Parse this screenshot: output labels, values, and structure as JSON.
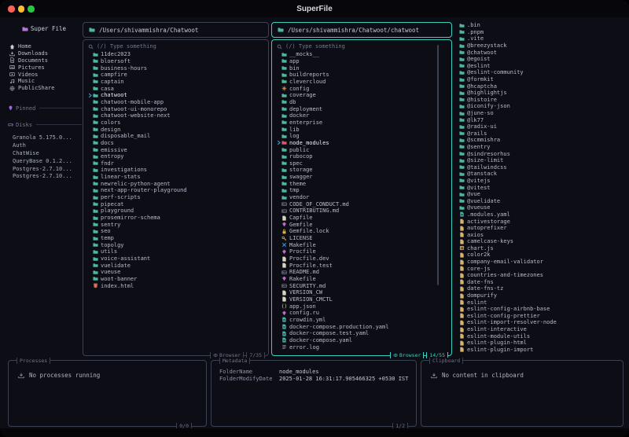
{
  "window": {
    "title": "SuperFile"
  },
  "colors": {
    "accent": "#39d0c2",
    "border": "#3a4150",
    "cursor_arrow": "#38a8e8",
    "background": "#0d0d16",
    "folder": "#4db99c",
    "node_modules_folder": "#d4596b"
  },
  "icon_colors": {
    "folder": "#4db99c",
    "file": "#d8d4c2",
    "md": "#8a93a5",
    "gem": "#bd6bc9",
    "lock": "#d9b54e",
    "key": "#d9b54e",
    "tools": "#5a9fd6",
    "braces": "#d9b54e",
    "yaml": "#45b7aa",
    "log": "#9aa2b1",
    "html": "#dd6b45",
    "gear": "#d98c4a",
    "js": "#d98c4a",
    "pkg": "#d8b46a",
    "home": "#c2c7d2",
    "tray": "#aeb8c8",
    "docfile": "#c2c7d2",
    "pictures": "#c2c7d2",
    "videos": "#c2c7d2",
    "music": "#aeb8c8",
    "globe": "#aeb8c8"
  },
  "sidebar": {
    "title": "Super File",
    "nav": [
      {
        "icon": "home",
        "label": "Home"
      },
      {
        "icon": "tray",
        "label": "Downloads"
      },
      {
        "icon": "docfile",
        "label": "Documents"
      },
      {
        "icon": "pictures",
        "label": "Pictures"
      },
      {
        "icon": "videos",
        "label": "Videos"
      },
      {
        "icon": "music",
        "label": "Music"
      },
      {
        "icon": "globe",
        "label": "PublicShare"
      }
    ],
    "pinned_label": "Pinned",
    "disks_label": "Disks",
    "disks": [
      {
        "label": "Granola 5.175.0..."
      },
      {
        "label": "Auth"
      },
      {
        "label": "ChatWise"
      },
      {
        "label": "QueryBase 0.1.2..."
      },
      {
        "label": "Postgres-2.7.10..."
      },
      {
        "label": "Postgres-2.7.10..."
      }
    ]
  },
  "panel1": {
    "path": "/Users/shivammishra/Chatwoot",
    "search_placeholder": "(/) Type something",
    "footer_label": "Browser",
    "footer_count": "7/35",
    "files": [
      {
        "icon": "folder",
        "name": "11dec2023"
      },
      {
        "icon": "folder",
        "name": "bloersoft"
      },
      {
        "icon": "folder",
        "name": "business-hours"
      },
      {
        "icon": "folder",
        "name": "campfire"
      },
      {
        "icon": "folder",
        "name": "captain"
      },
      {
        "icon": "folder",
        "name": "casa"
      },
      {
        "icon": "folder",
        "name": "chatwoot",
        "selected": true
      },
      {
        "icon": "folder",
        "name": "chatwoot-mobile-app"
      },
      {
        "icon": "folder",
        "name": "chatwoot-ui-monorepo"
      },
      {
        "icon": "folder",
        "name": "chatwoot-website-next"
      },
      {
        "icon": "folder",
        "name": "colors"
      },
      {
        "icon": "folder",
        "name": "design"
      },
      {
        "icon": "folder",
        "name": "disposable_mail"
      },
      {
        "icon": "folder",
        "name": "docs"
      },
      {
        "icon": "folder",
        "name": "emissive"
      },
      {
        "icon": "folder",
        "name": "entropy"
      },
      {
        "icon": "folder",
        "name": "fndr"
      },
      {
        "icon": "folder",
        "name": "investigations"
      },
      {
        "icon": "folder",
        "name": "linear-stats"
      },
      {
        "icon": "folder",
        "name": "newrelic-python-agent"
      },
      {
        "icon": "folder",
        "name": "next-app-router-playground"
      },
      {
        "icon": "folder",
        "name": "perf-scripts"
      },
      {
        "icon": "folder",
        "name": "pipecat"
      },
      {
        "icon": "folder",
        "name": "playground"
      },
      {
        "icon": "folder",
        "name": "prosemirror-schema"
      },
      {
        "icon": "folder",
        "name": "sentry"
      },
      {
        "icon": "folder",
        "name": "seo"
      },
      {
        "icon": "folder",
        "name": "temp"
      },
      {
        "icon": "folder",
        "name": "topolgy"
      },
      {
        "icon": "folder",
        "name": "utils"
      },
      {
        "icon": "folder",
        "name": "voice-assistant"
      },
      {
        "icon": "folder",
        "name": "vuelidate"
      },
      {
        "icon": "folder",
        "name": "vueuse"
      },
      {
        "icon": "folder",
        "name": "woot-banner"
      },
      {
        "icon": "html",
        "name": "index.html"
      }
    ]
  },
  "panel2": {
    "path": "/Users/shivammishra/Chatwoot/chatwoot",
    "search_placeholder": "(/) Type something",
    "footer_label": "Browser",
    "footer_count": "14/55",
    "files": [
      {
        "icon": "folder",
        "name": "__mocks__"
      },
      {
        "icon": "folder",
        "name": "app"
      },
      {
        "icon": "folder",
        "name": "bin"
      },
      {
        "icon": "folder",
        "name": "buildreports"
      },
      {
        "icon": "folder",
        "name": "clevercloud"
      },
      {
        "icon": "gear",
        "name": "config"
      },
      {
        "icon": "folder",
        "name": "coverage"
      },
      {
        "icon": "folder",
        "name": "db"
      },
      {
        "icon": "folder",
        "name": "deployment"
      },
      {
        "icon": "folder",
        "name": "docker"
      },
      {
        "icon": "folder",
        "name": "enterprise"
      },
      {
        "icon": "folder",
        "name": "lib"
      },
      {
        "icon": "folder",
        "name": "log"
      },
      {
        "icon": "folder",
        "name": "node_modules",
        "color": "#d4596b",
        "selected": true
      },
      {
        "icon": "folder",
        "name": "public"
      },
      {
        "icon": "folder",
        "name": "rubocop"
      },
      {
        "icon": "folder",
        "name": "spec"
      },
      {
        "icon": "folder",
        "name": "storage"
      },
      {
        "icon": "folder",
        "name": "swagger"
      },
      {
        "icon": "folder",
        "name": "theme"
      },
      {
        "icon": "folder",
        "name": "tmp"
      },
      {
        "icon": "folder",
        "name": "vendor"
      },
      {
        "icon": "md",
        "name": "CODE_OF_CONDUCT.md"
      },
      {
        "icon": "md",
        "name": "CONTRIBUTING.md"
      },
      {
        "icon": "file",
        "name": "Capfile"
      },
      {
        "icon": "gem",
        "name": "Gemfile"
      },
      {
        "icon": "lock",
        "name": "Gemfile.lock"
      },
      {
        "icon": "key",
        "name": "LICENSE"
      },
      {
        "icon": "tools",
        "name": "Makefile"
      },
      {
        "icon": "gem",
        "name": "Procfile"
      },
      {
        "icon": "file",
        "name": "Procfile.dev"
      },
      {
        "icon": "file",
        "name": "Procfile.test"
      },
      {
        "icon": "md",
        "name": "README.md"
      },
      {
        "icon": "gem",
        "name": "Rakefile"
      },
      {
        "icon": "md",
        "name": "SECURITY.md"
      },
      {
        "icon": "file",
        "name": "VERSION_CW"
      },
      {
        "icon": "file",
        "name": "VERSION_CMCTL"
      },
      {
        "icon": "braces",
        "name": "app.json"
      },
      {
        "icon": "gem",
        "name": "config.ru"
      },
      {
        "icon": "yaml",
        "name": "crowdin.yml"
      },
      {
        "icon": "yaml",
        "name": "docker-compose.production.yaml"
      },
      {
        "icon": "yaml",
        "name": "docker-compose.test.yaml"
      },
      {
        "icon": "yaml",
        "name": "docker-compose.yaml"
      },
      {
        "icon": "log",
        "name": "error.log"
      }
    ]
  },
  "preview": {
    "files": [
      {
        "icon": "folder",
        "name": ".bin"
      },
      {
        "icon": "folder",
        "name": ".pnpm"
      },
      {
        "icon": "folder",
        "name": ".vite"
      },
      {
        "icon": "folder",
        "name": "@breezystack"
      },
      {
        "icon": "folder",
        "name": "@chatwoot"
      },
      {
        "icon": "folder",
        "name": "@egoist"
      },
      {
        "icon": "folder",
        "name": "@eslint"
      },
      {
        "icon": "folder",
        "name": "@eslint-community"
      },
      {
        "icon": "folder",
        "name": "@formkit"
      },
      {
        "icon": "folder",
        "name": "@hcaptcha"
      },
      {
        "icon": "folder",
        "name": "@highlightjs"
      },
      {
        "icon": "folder",
        "name": "@histoire"
      },
      {
        "icon": "folder",
        "name": "@iconify-json"
      },
      {
        "icon": "folder",
        "name": "@june-so"
      },
      {
        "icon": "folder",
        "name": "@lk77"
      },
      {
        "icon": "folder",
        "name": "@radix-ui"
      },
      {
        "icon": "folder",
        "name": "@rails"
      },
      {
        "icon": "folder",
        "name": "@scmmishra"
      },
      {
        "icon": "folder",
        "name": "@sentry"
      },
      {
        "icon": "folder",
        "name": "@sindresorhus"
      },
      {
        "icon": "folder",
        "name": "@size-limit"
      },
      {
        "icon": "folder",
        "name": "@tailwindcss"
      },
      {
        "icon": "folder",
        "name": "@tanstack"
      },
      {
        "icon": "folder",
        "name": "@vitejs"
      },
      {
        "icon": "folder",
        "name": "@vitest"
      },
      {
        "icon": "folder",
        "name": "@vue"
      },
      {
        "icon": "folder",
        "name": "@vuelidate"
      },
      {
        "icon": "folder",
        "name": "@vueuse"
      },
      {
        "icon": "yaml",
        "name": ".modules.yaml"
      },
      {
        "icon": "pkg",
        "name": "activestorage"
      },
      {
        "icon": "pkg",
        "name": "autoprefixer"
      },
      {
        "icon": "pkg",
        "name": "axios"
      },
      {
        "icon": "pkg",
        "name": "camelcase-keys"
      },
      {
        "icon": "js",
        "name": "chart.js"
      },
      {
        "icon": "pkg",
        "name": "color2k"
      },
      {
        "icon": "pkg",
        "name": "company-email-validator"
      },
      {
        "icon": "pkg",
        "name": "core-js"
      },
      {
        "icon": "pkg",
        "name": "countries-and-timezones"
      },
      {
        "icon": "pkg",
        "name": "date-fns"
      },
      {
        "icon": "pkg",
        "name": "date-fns-tz"
      },
      {
        "icon": "pkg",
        "name": "dompurify"
      },
      {
        "icon": "pkg",
        "name": "eslint"
      },
      {
        "icon": "pkg",
        "name": "eslint-config-airbnb-base"
      },
      {
        "icon": "pkg",
        "name": "eslint-config-prettier"
      },
      {
        "icon": "pkg",
        "name": "eslint-import-resolver-node"
      },
      {
        "icon": "pkg",
        "name": "eslint-interactive"
      },
      {
        "icon": "pkg",
        "name": "eslint-module-utils"
      },
      {
        "icon": "pkg",
        "name": "eslint-plugin-html"
      },
      {
        "icon": "pkg",
        "name": "eslint-plugin-import"
      }
    ]
  },
  "bottom": {
    "processes": {
      "title": "Processes",
      "empty": "No processes running",
      "count": "0/0"
    },
    "metadata": {
      "title": "Metadata",
      "count": "1/2",
      "rows": [
        {
          "key": "FolderName",
          "value": "node_modules"
        },
        {
          "key": "FolderModifyDate",
          "value": "2025-01-28 16:31:17.905466325 +0530 IST"
        }
      ]
    },
    "clipboard": {
      "title": "Clipboard",
      "empty": "No content in clipboard"
    }
  }
}
